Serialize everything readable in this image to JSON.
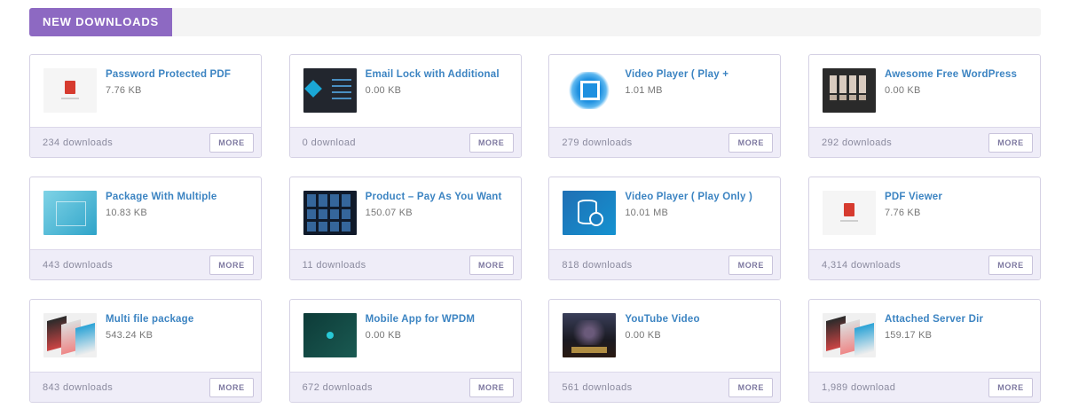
{
  "section": {
    "title": "NEW DOWNLOADS"
  },
  "colors": {
    "accent": "#8d69c2",
    "link": "#3c84c2",
    "footer": "#efedf8"
  },
  "more_label": "MORE",
  "items": [
    {
      "title": "Password Protected PDF",
      "size": "7.76 KB",
      "downloads": "234 downloads",
      "thumb": "pdf-icon"
    },
    {
      "title": "Email Lock with Additional",
      "size": "0.00 KB",
      "downloads": "0 download",
      "thumb": "email-lock-icon"
    },
    {
      "title": "Video Player ( Play +",
      "size": "1.01 MB",
      "downloads": "279 downloads",
      "thumb": "video-splash-icon"
    },
    {
      "title": "Awesome Free WordPress",
      "size": "0.00 KB",
      "downloads": "292 downloads",
      "thumb": "wordpress-theme-icon"
    },
    {
      "title": "Package With Multiple",
      "size": "10.83 KB",
      "downloads": "443 downloads",
      "thumb": "package-icon"
    },
    {
      "title": "Product – Pay As You Want",
      "size": "150.07 KB",
      "downloads": "11 downloads",
      "thumb": "product-grid-icon"
    },
    {
      "title": "Video Player ( Play Only )",
      "size": "10.01 MB",
      "downloads": "818 downloads",
      "thumb": "database-download-icon"
    },
    {
      "title": "PDF Viewer",
      "size": "7.76 KB",
      "downloads": "4,314 downloads",
      "thumb": "pdf-icon"
    },
    {
      "title": "Multi file package",
      "size": "543.24 KB",
      "downloads": "843 downloads",
      "thumb": "screens-icon"
    },
    {
      "title": "Mobile App for WPDM",
      "size": "0.00 KB",
      "downloads": "672 downloads",
      "thumb": "mobile-app-icon"
    },
    {
      "title": "YouTube Video",
      "size": "0.00 KB",
      "downloads": "561 downloads",
      "thumb": "game-poster-icon"
    },
    {
      "title": "Attached Server Dir",
      "size": "159.17 KB",
      "downloads": "1,989 download",
      "thumb": "screens-icon"
    }
  ]
}
